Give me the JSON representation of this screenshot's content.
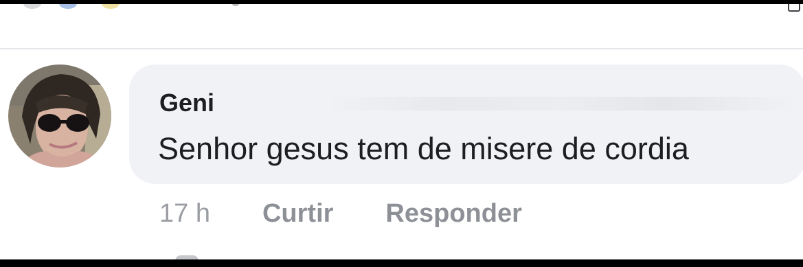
{
  "comment": {
    "author": "Geni",
    "text": "Senhor gesus tem de misere de cordia",
    "time": "17 h",
    "actions": {
      "like": "Curtir",
      "reply": "Responder"
    },
    "avatar_icon": "profile-photo-woman-sunglasses-icon"
  },
  "colors": {
    "bubble": "#f0f2f5",
    "text": "#1c1e21",
    "secondary": "#8d9096",
    "background": "#ffffff",
    "frame": "#000000"
  }
}
